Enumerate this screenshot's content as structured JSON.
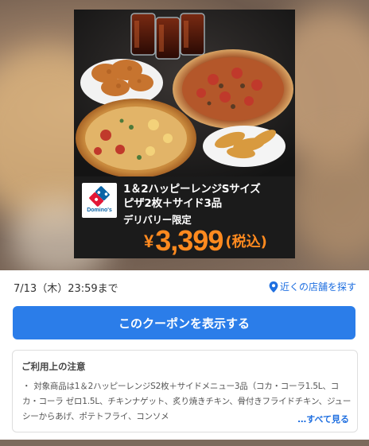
{
  "promo": {
    "headline_line1": "1＆2ハッピーレンジSサイズ",
    "headline_line2": "ピザ2枚＋サイド3品",
    "headline_line3": "デリバリー限定",
    "price_yen": "¥",
    "price_amount": "3,399",
    "price_tax": "(税込)",
    "brand": "Domino's",
    "colors": {
      "price": "#ff8a1f",
      "brand_blue": "#0b65a7",
      "brand_red": "#e31837"
    }
  },
  "coupon": {
    "expiry": "7/13（木）23:59まで",
    "nearby_label": "近くの店舗を探す",
    "cta_label": "このクーポンを表示する",
    "accent": "#2b7de9"
  },
  "notes": {
    "title": "ご利用上の注意",
    "bullet": "・",
    "text": "対象商品は1＆2ハッピーレンジS2枚＋サイドメニュー3品（コカ・コーラ1.5L、コカ・コーラ ゼロ1.5L、チキンナゲット、炙り焼きチキン、骨付きフライドチキン、ジューシーからあげ、ポテトフライ、コンソメ",
    "more_label": "…すべて見る"
  },
  "icons": {
    "location": "location-pin-icon"
  }
}
